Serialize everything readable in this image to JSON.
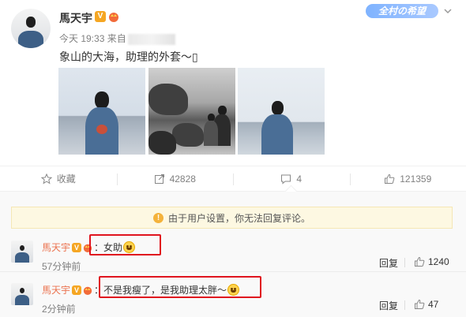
{
  "post": {
    "author": "馬天宇",
    "time": "今天 19:33 来自",
    "text": "象山的大海，助理的外套～▯",
    "top_badge": "全村の希望",
    "photos": [
      "photo-1",
      "photo-2",
      "photo-3"
    ]
  },
  "actions": {
    "favorite": "收藏",
    "repost_count": "42828",
    "comment_count": "4",
    "like_count": "121359"
  },
  "comments": {
    "notice": "由于用户设置，你无法回复评论。",
    "items": [
      {
        "name": "馬天宇",
        "text": "：女助",
        "time": "57分钟前",
        "reply": "回复",
        "likes": "1240"
      },
      {
        "name": "馬天宇",
        "text": "：不是我瘦了，是我助理太胖～",
        "time": "2分钟前",
        "reply": "回复",
        "likes": "47"
      }
    ]
  },
  "colors": {
    "name_orange": "#eb7350",
    "highlight_red": "#e0141e",
    "notice_bg": "#fdf8e2",
    "badge_gold": "#f5a623"
  }
}
